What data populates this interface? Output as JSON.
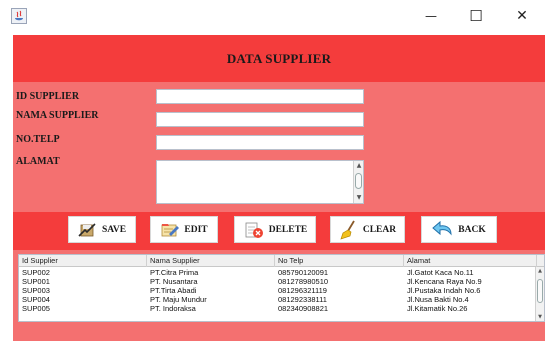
{
  "window": {
    "minimize_glyph": "—",
    "maximize_glyph": "☐",
    "close_glyph": "✕"
  },
  "header": {
    "title": "DATA SUPPLIER"
  },
  "form": {
    "id_label": "ID SUPPLIER",
    "name_label": "NAMA SUPPLIER",
    "phone_label": "NO.TELP",
    "address_label": "ALAMAT",
    "id_value": "",
    "name_value": "",
    "phone_value": "",
    "address_value": ""
  },
  "buttons": {
    "save": "SAVE",
    "edit": "EDIT",
    "delete": "DELETE",
    "clear": "CLEAR",
    "back": "BACK"
  },
  "table": {
    "columns": [
      "Id Supplier",
      "Nama Supplier",
      "No Telp",
      "Alamat"
    ],
    "rows": [
      [
        "SUP002",
        "PT.Citra Prima",
        "085790120091",
        "Jl.Gatot Kaca No.11"
      ],
      [
        "SUP001",
        "PT. Nusantara",
        "081278980510",
        "Jl.Kencana Raya No.9"
      ],
      [
        "SUP003",
        "PT.Tirta Abadi",
        "081296321119",
        "Jl.Pustaka Indah No.6"
      ],
      [
        "SUP004",
        "PT. Maju Mundur",
        "081292338111",
        "Jl.Nusa Bakti No.4"
      ],
      [
        "SUP005",
        "PT. Indoraksa",
        "082340908821",
        "Jl.Kitamatik No.26"
      ]
    ]
  },
  "colors": {
    "header_red": "#f43c3c",
    "form_pink": "#f47070"
  },
  "icons": {
    "app": "java-app-icon",
    "save": "save-icon",
    "edit": "edit-icon",
    "delete": "delete-icon",
    "clear": "broom-icon",
    "back": "back-arrow-icon"
  }
}
